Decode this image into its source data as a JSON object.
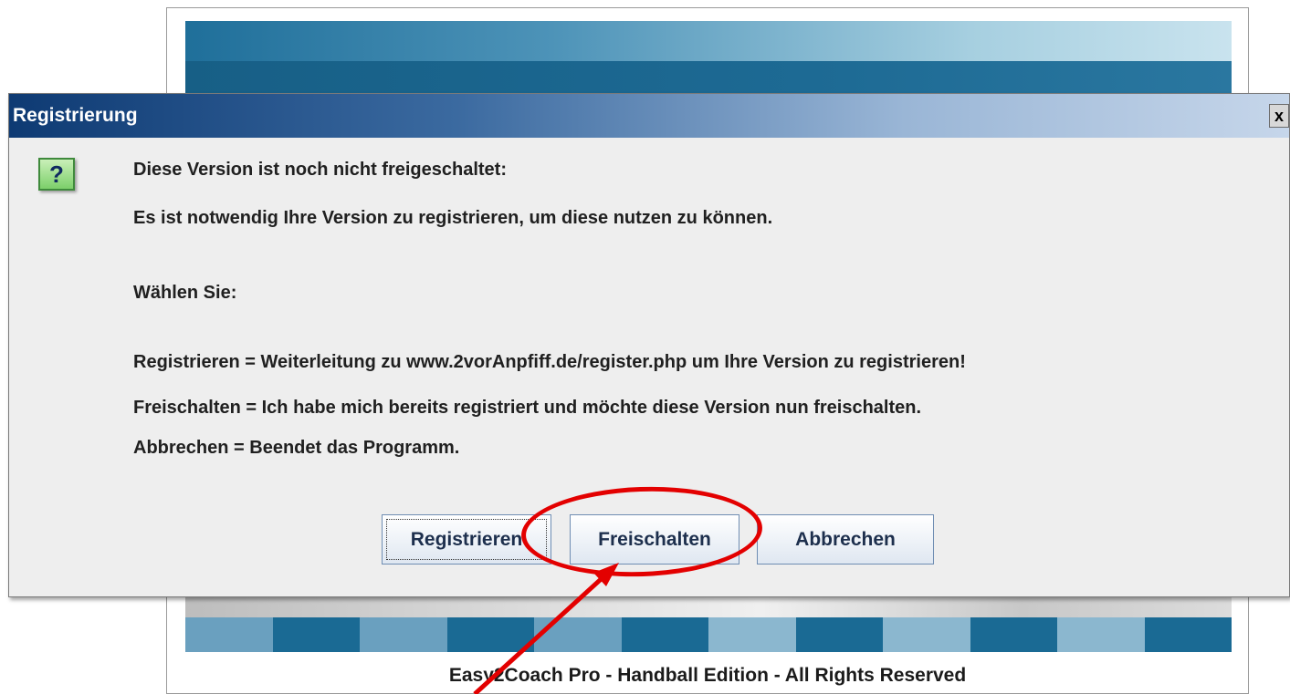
{
  "splash": {
    "footer": "Easy2Coach Pro - Handball Edition - All Rights Reserved",
    "tile_colors": [
      "#6aa0bf",
      "#1a6a94",
      "#6aa0bf",
      "#1a6a94",
      "#6aa0bf",
      "#1a6a94",
      "#8bb7cf",
      "#1a6a94",
      "#8bb7cf",
      "#1a6a94",
      "#8bb7cf",
      "#1a6a94"
    ]
  },
  "dialog": {
    "title": "Registrierung",
    "close_label": "x",
    "icon_glyph": "?",
    "lines": [
      "Diese Version ist noch nicht freigeschaltet:",
      "Es ist notwendig Ihre Version zu registrieren, um diese nutzen zu können.",
      "Wählen Sie:",
      "Registrieren = Weiterleitung zu www.2vorAnpfiff.de/register.php um Ihre Version zu registrieren!",
      "Freischalten = Ich habe mich bereits registriert und möchte diese Version nun freischalten.",
      "Abbrechen = Beendet das Programm."
    ],
    "buttons": {
      "register": "Registrieren",
      "unlock": "Freischalten",
      "cancel": "Abbrechen"
    }
  },
  "annotation": {
    "color": "#e30000",
    "highlighted_button": "Freischalten"
  }
}
